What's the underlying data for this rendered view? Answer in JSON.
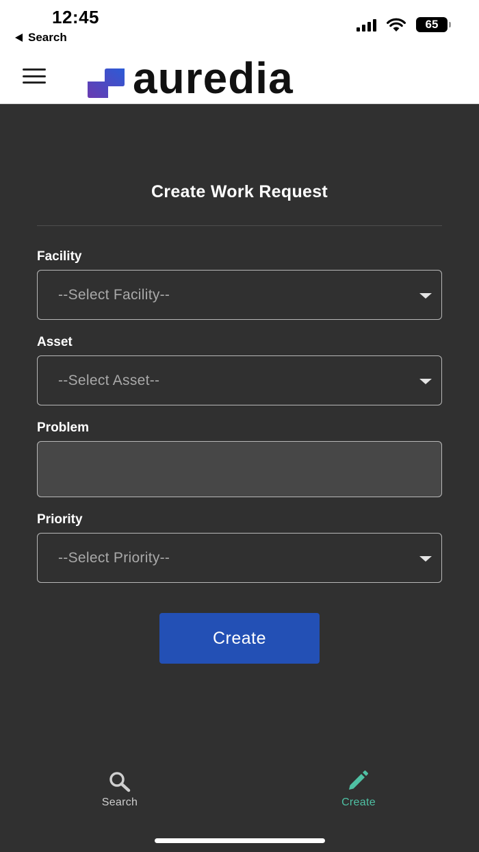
{
  "status_bar": {
    "time": "12:45",
    "back_label": "Search",
    "battery": "65"
  },
  "header": {
    "menu_icon": "hamburger-icon",
    "logo_text": "auredia",
    "logo_colors": [
      "#2c5bd6",
      "#6a3bb0"
    ]
  },
  "form": {
    "title": "Create Work Request",
    "facility": {
      "label": "Facility",
      "value": "--Select Facility--"
    },
    "asset": {
      "label": "Asset",
      "value": "--Select Asset--"
    },
    "problem": {
      "label": "Problem",
      "value": ""
    },
    "priority": {
      "label": "Priority",
      "value": "--Select Priority--"
    },
    "submit_label": "Create"
  },
  "bottom_nav": {
    "items": [
      {
        "label": "Search",
        "icon": "search-icon",
        "color": "#cfcfcf"
      },
      {
        "label": "Create",
        "icon": "pencil-icon",
        "color": "#4fc1a4",
        "active": true
      }
    ]
  },
  "colors": {
    "background": "#303030",
    "primary_button": "#2350b5",
    "active_nav": "#4fc1a4"
  }
}
